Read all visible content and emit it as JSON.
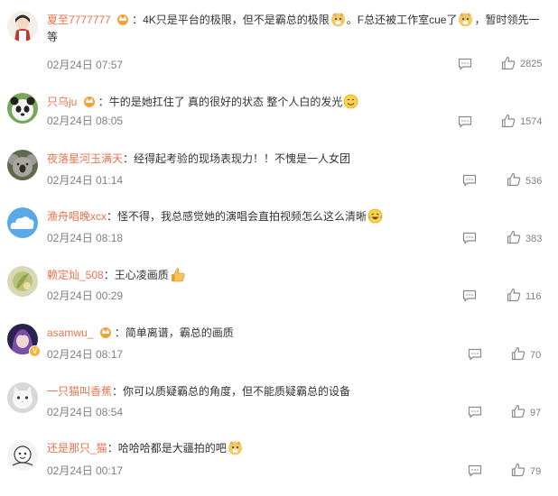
{
  "comments": [
    {
      "user": "夏至7777777",
      "colon": "：",
      "t1": "4K只是平台的极限，但不是霸总的极限",
      "t2": "。F总还被工作室cue了",
      "t3": "，暂时领先一等",
      "date": "02月24日 07:57",
      "likes": "2825",
      "avatar_icon": "girl-avatar-icon"
    },
    {
      "user": "只乌ju",
      "colon": "：",
      "t1": "牛的是她扛住了 真的很好的状态 整个人白的发光",
      "date": "02月24日 08:05",
      "likes": "1574",
      "avatar_icon": "panda-avatar-icon"
    },
    {
      "user": "夜落星河玉满天",
      "colon": "：",
      "t1": "经得起考验的现场表现力！！不愧是一人女团",
      "date": "02月24日 01:14",
      "likes": "536",
      "avatar_icon": "koala-avatar-icon"
    },
    {
      "user": "渔舟唱晚xcx",
      "colon": "：",
      "t1": "怪不得，我总感觉她的演唱会直拍视频怎么这么清晰",
      "date": "02月24日 08:18",
      "likes": "383",
      "avatar_icon": "cloud-avatar-icon"
    },
    {
      "user": "赖定灿_508",
      "colon": "：",
      "t1": "王心凌画质",
      "date": "02月24日 00:29",
      "likes": "116",
      "avatar_icon": "plant-avatar-icon"
    },
    {
      "user": "asamwu_",
      "colon": "：",
      "t1": "简单离谱，霸总的画质",
      "date": "02月24日 08:17",
      "likes": "70",
      "avatar_icon": "anime-avatar-icon"
    },
    {
      "user": "一只猫叫香蕉",
      "colon": "：",
      "t1": "你可以质疑霸总的角度，但不能质疑霸总的设备",
      "date": "02月24日 08:54",
      "likes": "97",
      "avatar_icon": "cat-avatar-icon"
    },
    {
      "user": "还是那只_猫",
      "colon": "：",
      "t1": "哈哈哈都是大疆拍的吧",
      "date": "02月24日 00:17",
      "likes": "79",
      "avatar_icon": "cartoon-avatar-icon"
    }
  ],
  "colors": {
    "username": "#eb7350",
    "text": "#333333",
    "meta": "#808080",
    "crown": "#f2a33c",
    "badge": "#f5b731"
  }
}
